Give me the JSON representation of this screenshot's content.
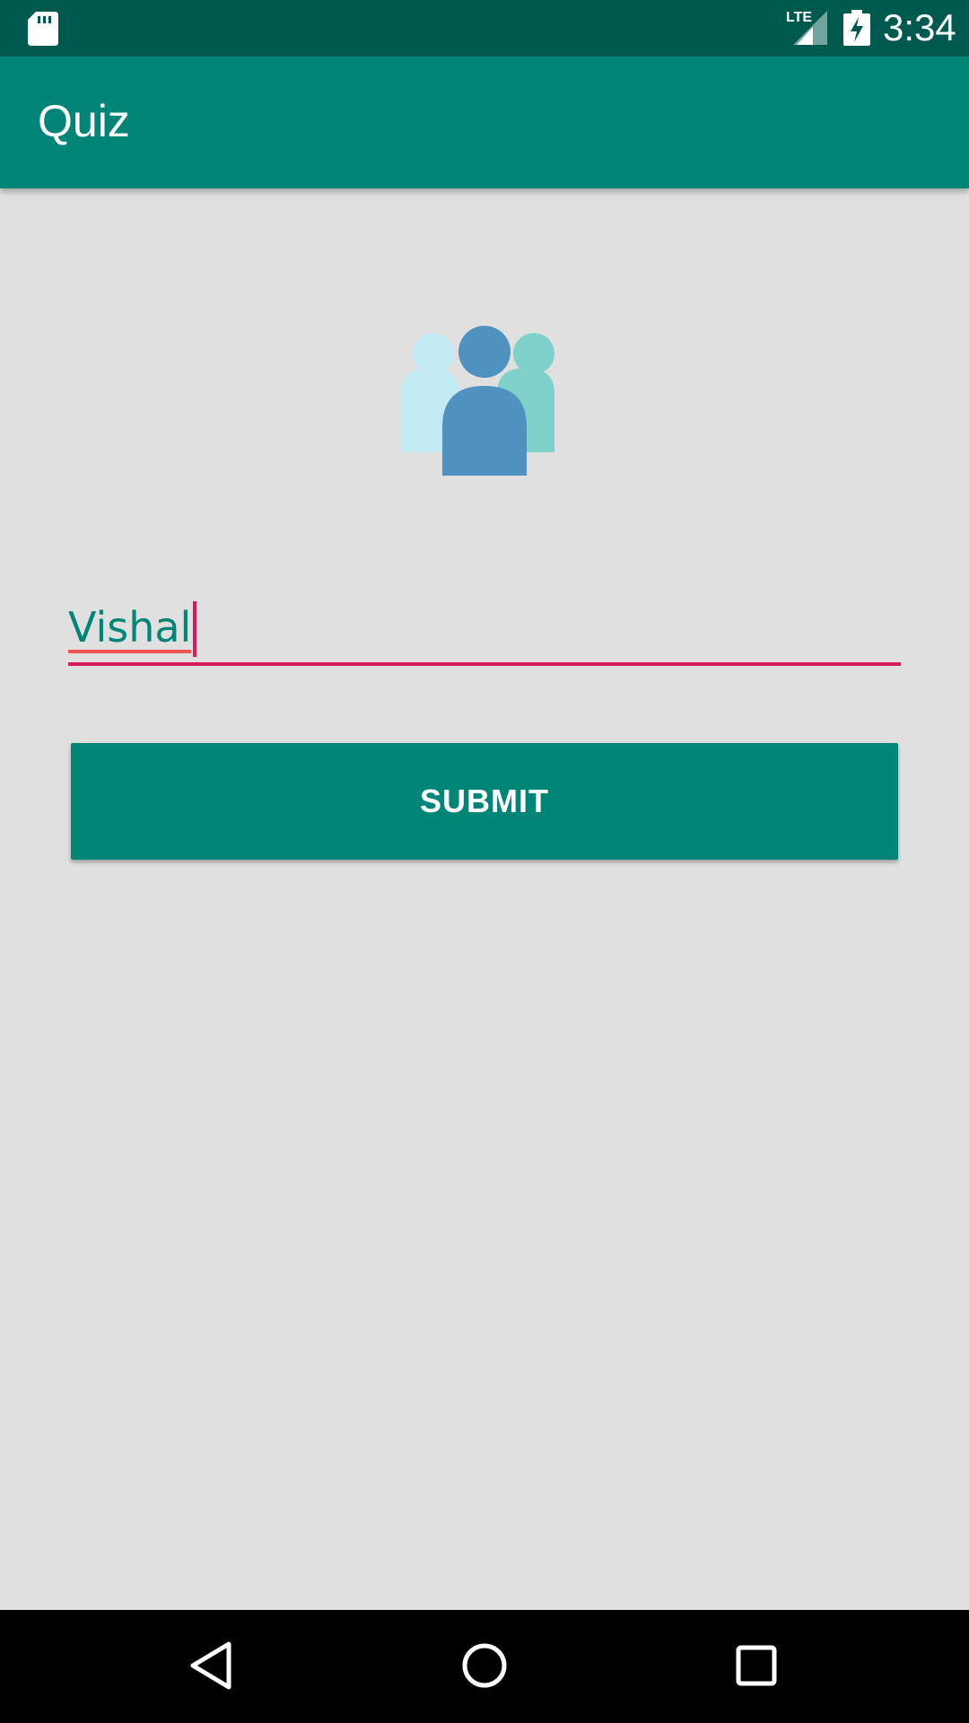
{
  "status_bar": {
    "time": "3:34",
    "network_label": "LTE",
    "icons": [
      "sd-card-icon",
      "signal-lte-icon",
      "battery-charging-icon"
    ]
  },
  "app_bar": {
    "title": "Quiz"
  },
  "illustration": {
    "icon": "people-group-icon"
  },
  "name_input": {
    "value": "Vishal"
  },
  "submit_button": {
    "label": "SUBMIT"
  },
  "nav_bar": {
    "icons": [
      "back-icon",
      "home-icon",
      "recents-icon"
    ]
  },
  "colors": {
    "status_bar": "#00594f",
    "primary": "#008577",
    "accent": "#d81b60",
    "background": "#e0e0e0",
    "spellcheck_underline": "#ef5350",
    "illustration_left": "#c2eaf2",
    "illustration_center": "#5092bf",
    "illustration_right": "#7fd2cb"
  }
}
